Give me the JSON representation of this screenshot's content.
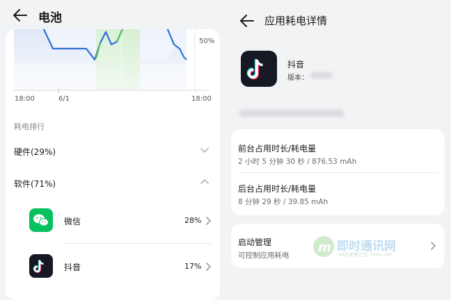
{
  "left": {
    "title": "电池",
    "chart": {
      "pct_label": "50%",
      "x_labels": [
        "18:00",
        "6/1",
        "18:00"
      ]
    },
    "section_title": "耗电排行",
    "hardware": "硬件(29%)",
    "software": "软件(71%)",
    "apps": [
      {
        "name": "微信",
        "pct": "28%",
        "icon": "wechat-icon"
      },
      {
        "name": "抖音",
        "pct": "17%",
        "icon": "douyin-icon"
      }
    ]
  },
  "right": {
    "title": "应用耗电详情",
    "app_name": "抖音",
    "version_label": "版本：",
    "foreground": {
      "title": "前台占用时长/耗电量",
      "value": "2 小时 5 分钟 30 秒 / 876.53 mAh"
    },
    "background": {
      "title": "后台占用时长/耗电量",
      "value": "8 分钟 29 秒 / 39.85 mAh"
    },
    "startup": {
      "title": "启动管理",
      "desc": "可控制应用耗电"
    },
    "watermark": {
      "text": "即时通讯网",
      "sub": "IM开发者社区 52im.net"
    }
  },
  "colors": {
    "accent_blue": "#2f6fd2",
    "charge_green": "#5cbf5c",
    "wechat_green": "#07c160",
    "douyin_black": "#161823"
  }
}
